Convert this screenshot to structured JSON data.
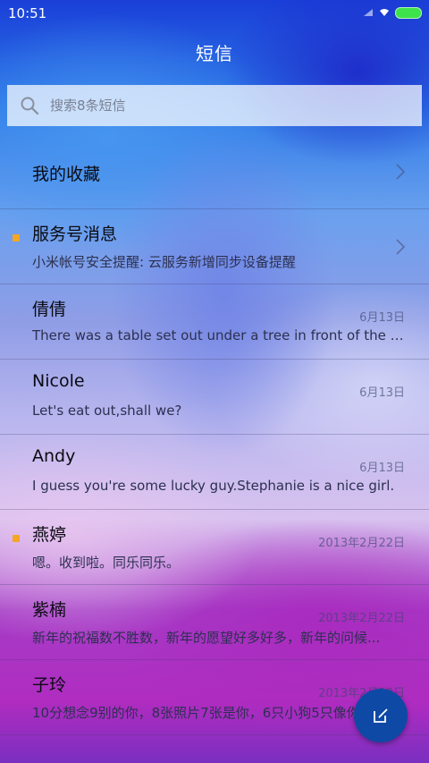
{
  "status_bar": {
    "time": "10:51",
    "battery_color": "#3ee24a"
  },
  "header": {
    "title": "短信"
  },
  "search": {
    "placeholder": "搜索8条短信"
  },
  "favorites": {
    "label": "我的收藏"
  },
  "conversations": [
    {
      "name": "服务号消息",
      "preview": "小米帐号安全提醒: 云服务新增同步设备提醒",
      "date": "",
      "unread": true,
      "chevron": true
    },
    {
      "name": "倩倩",
      "preview": "There was a table set out under a tree in front of the ho...",
      "date": "6月13日",
      "unread": false,
      "chevron": false
    },
    {
      "name": "Nicole",
      "preview": "Let's eat out,shall we?",
      "date": "6月13日",
      "unread": false,
      "chevron": false
    },
    {
      "name": "Andy",
      "preview": "I guess you're some lucky guy.Stephanie is a nice girl.",
      "date": "6月13日",
      "unread": false,
      "chevron": false
    },
    {
      "name": "燕婷",
      "preview": "嗯。收到啦。同乐同乐。",
      "date": "2013年2月22日",
      "unread": true,
      "chevron": false
    },
    {
      "name": "紫楠",
      "preview": "新年的祝福数不胜数，新年的愿望好多好多，新年的问候...",
      "date": "2013年2月22日",
      "unread": false,
      "chevron": false
    },
    {
      "name": "子玲",
      "preview": "10分想念9别的你，8张照片7张是你，6只小狗5只像你...",
      "date": "2013年2月22日",
      "unread": false,
      "chevron": false
    }
  ],
  "fab": {
    "icon": "compose-icon",
    "color": "#0f49a6"
  },
  "colors": {
    "unread_dot": "#f5a623"
  }
}
